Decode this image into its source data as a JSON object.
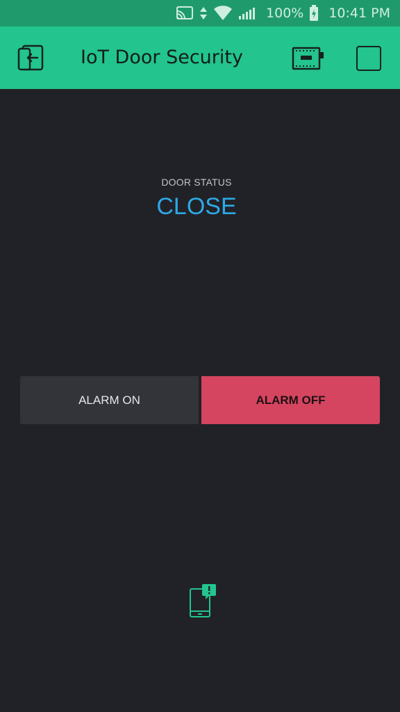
{
  "status_bar": {
    "battery_percent": "100%",
    "time": "10:41 PM",
    "icons": [
      "cast-icon",
      "data-arrows-icon",
      "wifi-icon",
      "signal-icon",
      "battery-charging-icon"
    ]
  },
  "app_bar": {
    "title": "IoT Door Security",
    "icons": [
      "exit-icon",
      "device-icon",
      "stop-icon"
    ],
    "color": "#23c48e"
  },
  "door_status": {
    "label": "DOOR STATUS",
    "value": "CLOSE",
    "value_color": "#2da9e7"
  },
  "alarm": {
    "on_label": "ALARM ON",
    "off_label": "ALARM OFF",
    "active": "off",
    "active_color": "#d54560"
  },
  "notification": {
    "icon": "phone-notification-icon"
  }
}
